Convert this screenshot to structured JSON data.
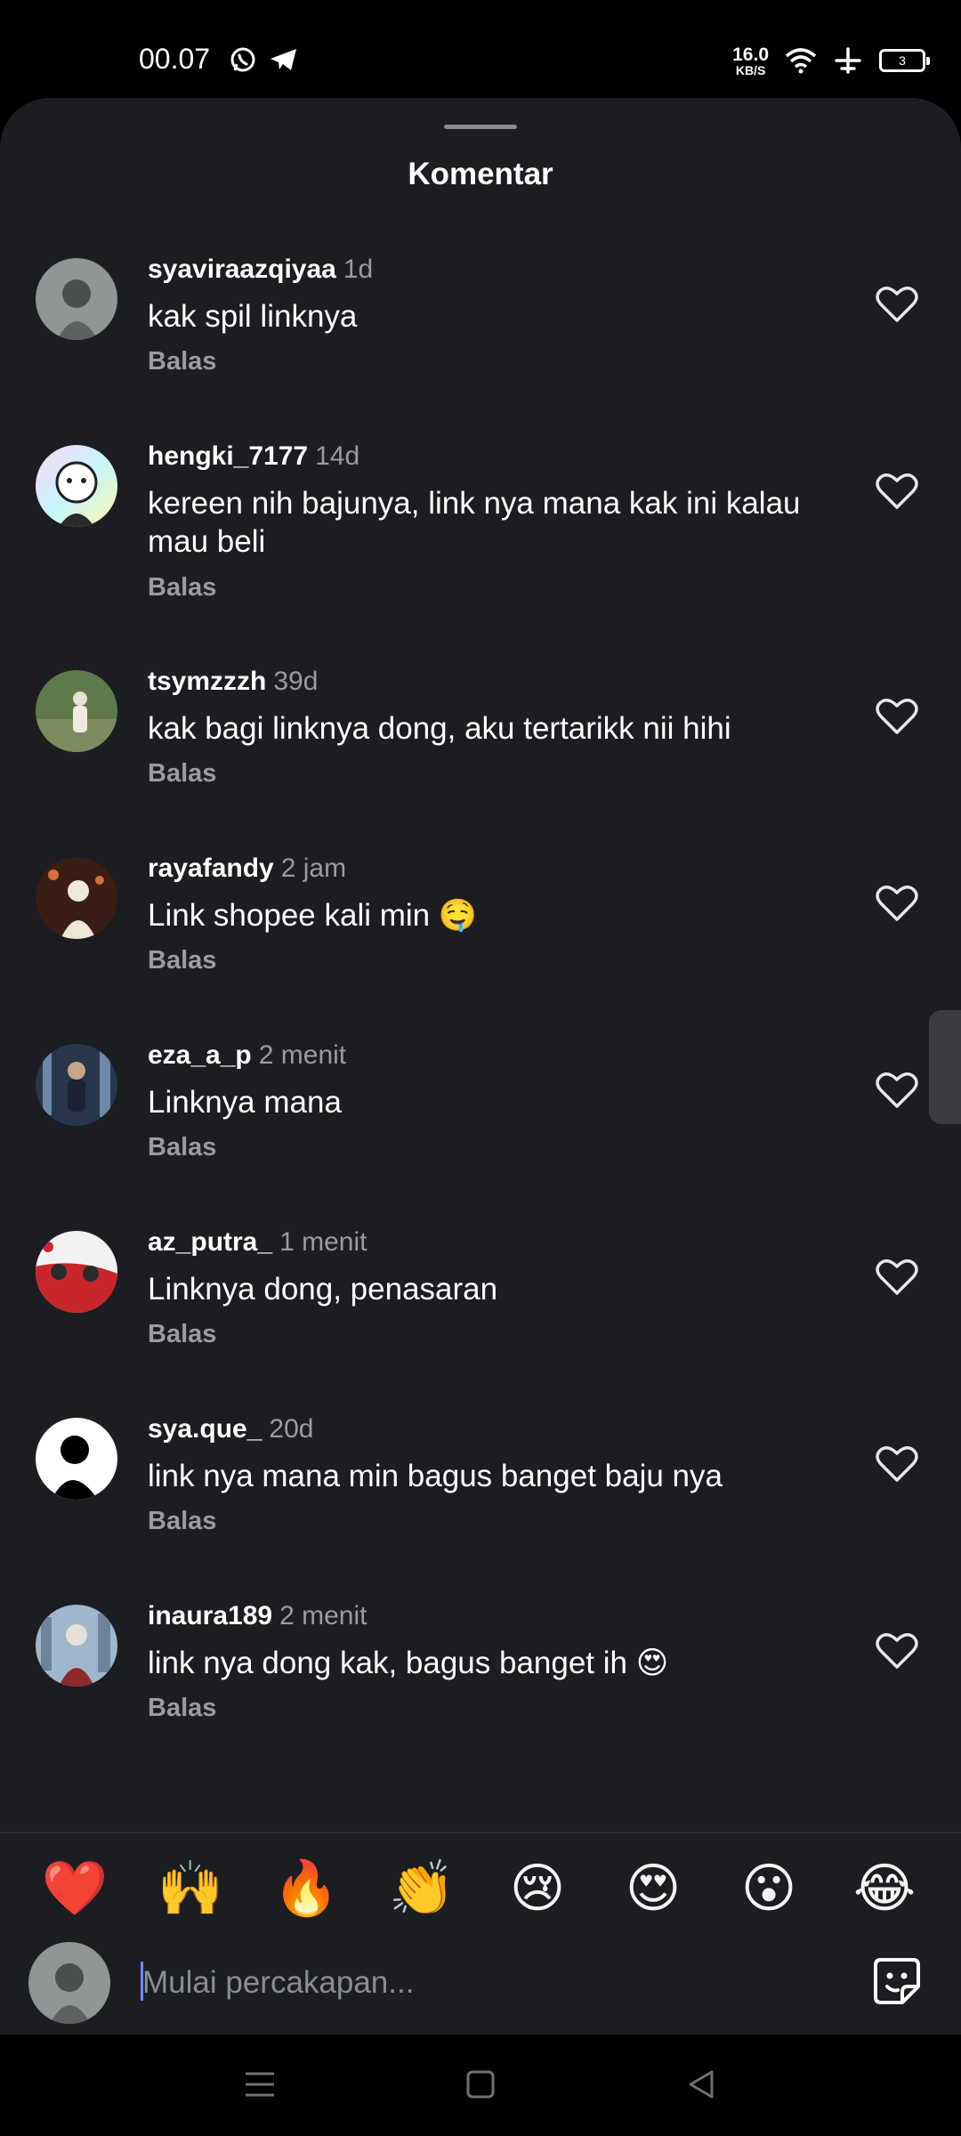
{
  "status_bar": {
    "time": "00.07",
    "net_speed_value": "16.0",
    "net_speed_unit": "KB/S",
    "battery_level": "3"
  },
  "sheet": {
    "title": "Komentar"
  },
  "comments": [
    {
      "username": "syaviraazqiyaa",
      "time": "1d",
      "text": "kak spil linknya",
      "reply": "Balas"
    },
    {
      "username": "hengki_7177",
      "time": "14d",
      "text": "kereen nih bajunya, link nya mana kak ini kalau mau beli",
      "reply": "Balas"
    },
    {
      "username": "tsymzzzh",
      "time": "39d",
      "text": "kak bagi linknya dong, aku tertarikk nii hihi",
      "reply": "Balas"
    },
    {
      "username": "rayafandy",
      "time": "2 jam",
      "text": "Link shopee kali min 🤤",
      "reply": "Balas"
    },
    {
      "username": "eza_a_p",
      "time": "2 menit",
      "text": "Linknya mana",
      "reply": "Balas"
    },
    {
      "username": "az_putra_",
      "time": "1 menit",
      "text": "Linknya dong, penasaran",
      "reply": "Balas"
    },
    {
      "username": "sya.que_",
      "time": "20d",
      "text": "link nya mana min bagus banget baju nya",
      "reply": "Balas"
    },
    {
      "username": "inaura189",
      "time": "2 menit",
      "text": "link nya dong kak, bagus banget ih 😍",
      "reply": "Balas"
    }
  ],
  "reactions": [
    "❤️",
    "🙌",
    "🔥",
    "👏",
    "😢",
    "😍",
    "😮",
    "😂"
  ],
  "composer": {
    "placeholder": "Mulai percakapan..."
  },
  "colors": {
    "background": "#1b1d20",
    "muted_text": "#9a9ca0",
    "caret": "#6b8cff"
  }
}
